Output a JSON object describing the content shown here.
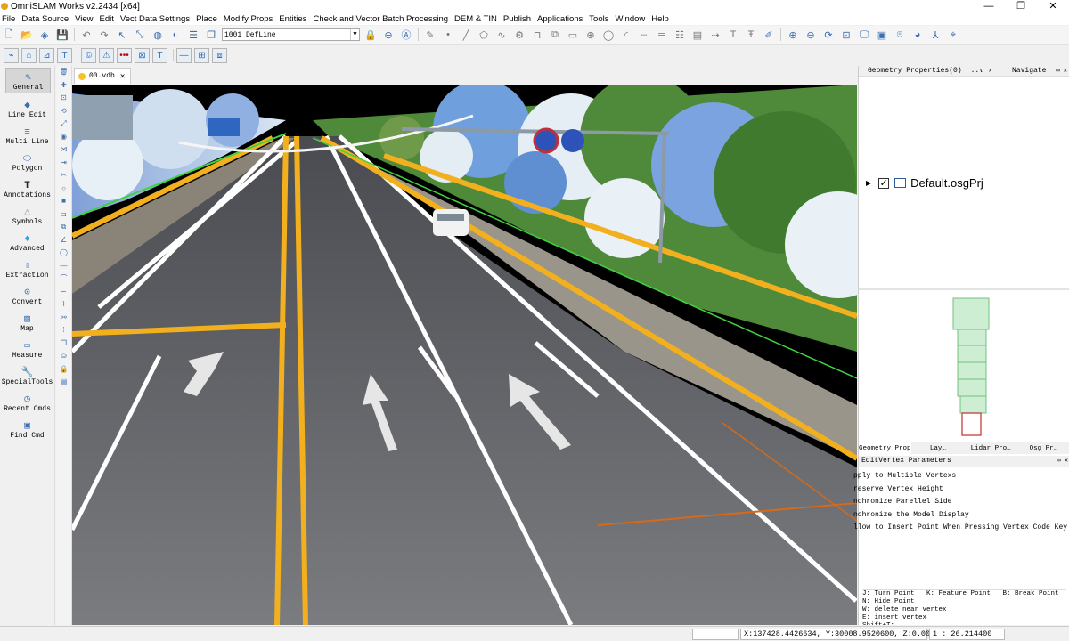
{
  "window": {
    "title": "OmniSLAM Works v2.2434 [x64]",
    "controls": [
      "—",
      "❐",
      "✕"
    ]
  },
  "menu": [
    "File",
    "Data Source",
    "View",
    "Edit",
    "Vect Data Settings",
    "Place",
    "Modify Props",
    "Entities",
    "Check and Vector Batch Processing",
    "DEM & TIN",
    "Publish",
    "Applications",
    "Tools",
    "Window",
    "Help"
  ],
  "toolbar": {
    "layer_select_value": "1001 DefLine"
  },
  "left_panel": {
    "items": [
      {
        "label": "General",
        "icon": "pen-icon"
      },
      {
        "label": "Line Edit",
        "icon": "line-edit-icon"
      },
      {
        "label": "Multi Line",
        "icon": "multi-line-icon"
      },
      {
        "label": "Polygon",
        "icon": "polygon-icon"
      },
      {
        "label": "Annotations",
        "icon": "text-icon"
      },
      {
        "label": "Symbols",
        "icon": "symbols-icon"
      },
      {
        "label": "Advanced",
        "icon": "diamond-icon"
      },
      {
        "label": "Extraction",
        "icon": "extraction-icon"
      },
      {
        "label": "Convert",
        "icon": "convert-icon"
      },
      {
        "label": "Map",
        "icon": "map-icon"
      },
      {
        "label": "Measure",
        "icon": "ruler-icon"
      },
      {
        "label": "SpecialTools",
        "icon": "wrench-icon"
      },
      {
        "label": "Recent Cmds",
        "icon": "clock-icon"
      },
      {
        "label": "Find Cmd",
        "icon": "find-icon"
      }
    ]
  },
  "document_tab": {
    "label": "00.vdb"
  },
  "right_panel": {
    "header": "Geometry Properties(0)",
    "header_more": "...",
    "nav_arrows": "‹  ›",
    "navigate_tab": "Navigate",
    "tree_root": "Default.osgPrj",
    "tabs": [
      "Geometry Prope…",
      "Lay…",
      "Lidar Pro…",
      "Osg Pr…"
    ],
    "edit_vertex": {
      "title": "EditVertex Parameters",
      "options": [
        "pply to Multiple Vertexs",
        "reserve Vertex Height",
        "nchronize Parellel Side",
        "nchronize the Model Display",
        "llow to Insert Point When Pressing Vertex Code Key"
      ],
      "key_hints": "J: Turn Point   K: Feature Point   B: Break Point\nN: Hide Point\nW: delete near vertex\nE: insert vertex\nShift+T: ..."
    }
  },
  "status": {
    "coords": "X:137428.4426634, Y:30008.9520600, Z:0.0000000",
    "scale": "1 : 26.214400"
  },
  "colors": {
    "accent": "#3a6fb0",
    "road_line_yellow": "#f2b01e",
    "asphalt": "#6b6d72",
    "tree_green": "#4f8a3a",
    "vector_green": "#3fd23f",
    "vector_orange": "#d46a1a"
  }
}
